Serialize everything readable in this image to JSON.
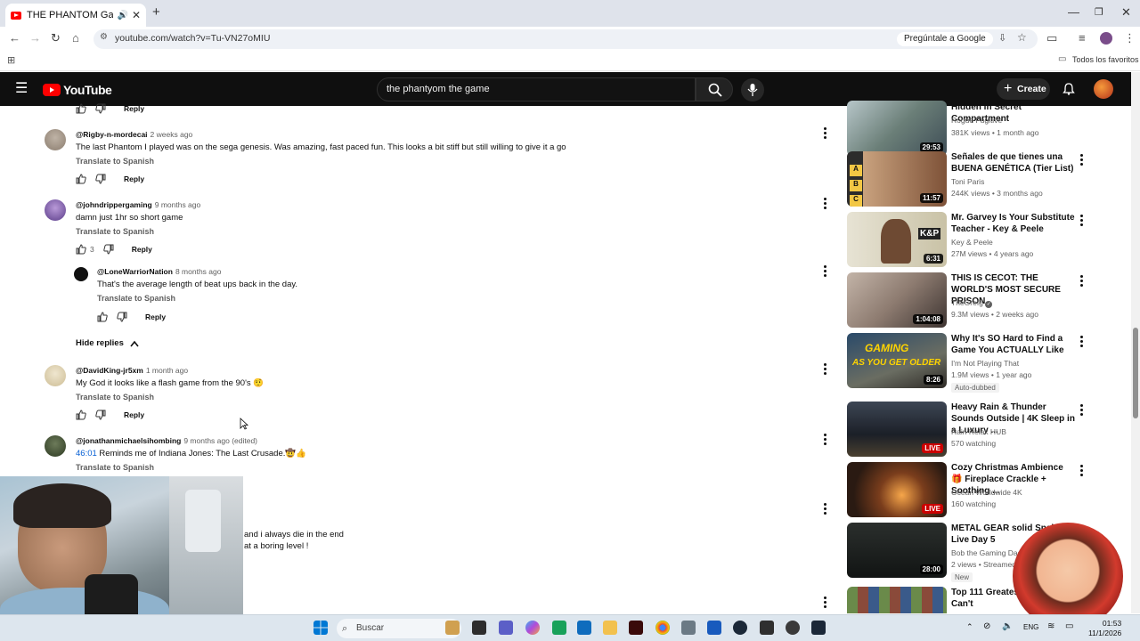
{
  "browser": {
    "tab_title": "THE PHANTOM Gameplay",
    "tab_close": "✕",
    "new_tab": "+",
    "url": "youtube.com/watch?v=Tu-VN27oMIU",
    "ask_google": "Pregúntale a Google",
    "all_bookmarks": "Todos los favoritos"
  },
  "youtube": {
    "logo_text": "YouTube",
    "search_value": "the phantyom the game",
    "create_label": "Create"
  },
  "comments": [
    {
      "handle": "@Rigby-n-mordecai",
      "age": "2 weeks ago",
      "text": "The last Phantom I played was on the sega genesis. Was amazing, fast paced fun. This looks a bit stiff but still willing to give it a go",
      "translate": "Translate to Spanish",
      "reply": "Reply"
    },
    {
      "handle": "@johndrippergaming",
      "age": "9 months ago",
      "text": "damn just 1hr so short game",
      "translate": "Translate to Spanish",
      "likes": "3",
      "reply": "Reply"
    },
    {
      "handle": "@LoneWarriorNation",
      "age": "8 months ago",
      "text": "That's the average length of beat ups back in the day.",
      "translate": "Translate to Spanish",
      "reply": "Reply"
    },
    {
      "handle": "@DavidKing-jr5xm",
      "age": "1 month ago",
      "text": "My God it looks like a flash game from the 90's 🤨",
      "translate": "Translate to Spanish",
      "reply": "Reply"
    },
    {
      "handle": "@jonathanmichaelsihombing",
      "age": "9 months ago (edited)",
      "timestamp": "46:01",
      "text": " Reminds me of Indiana Jones: The Last Crusade.🤠👍",
      "translate": "Translate to Spanish"
    }
  ],
  "top_reply": "Reply",
  "hide_replies": "Hide replies",
  "partial_comment": {
    "line1": "and i always die in the end",
    "line2": "at a boring level !"
  },
  "sidebar": [
    {
      "title": "Hidden in Secret Compartment",
      "channel": "Rogue Fugitive",
      "meta": "381K views • 1 month ago",
      "duration": "29:53"
    },
    {
      "title": "Señales de que tienes una BUENA GENÉTICA (Tier List)",
      "channel": "Toni Paris",
      "meta": "244K views • 3 months ago",
      "duration": "11:57"
    },
    {
      "title": "Mr. Garvey Is Your Substitute Teacher - Key & Peele",
      "channel": "Key & Peele",
      "meta": "27M views • 4 years ago",
      "duration": "6:31"
    },
    {
      "title": "THIS IS CECOT: THE WORLD'S MOST SECURE PRISON",
      "channel": "TheGrefg",
      "meta": "9.3M views • 2 weeks ago",
      "duration": "1:04:08"
    },
    {
      "title": "Why It's SO Hard to Find a Game You ACTUALLY Like",
      "channel": "I'm Not Playing That",
      "meta": "1.9M views • 1 year ago",
      "duration": "8:26",
      "badge": "Auto-dubbed"
    },
    {
      "title": "Heavy Rain & Thunder Sounds Outside | 4K Sleep in a Luxury ...",
      "channel": "Rain Relax HUB",
      "meta": "570 watching",
      "live": "LIVE"
    },
    {
      "title": "Cozy Christmas Ambience 🎁 Fireplace Crackle + Soothing ...",
      "channel": "Ocean Worldwide 4K",
      "meta": "160 watching",
      "live": "LIVE"
    },
    {
      "title": "METAL GEAR solid Snake Live Day 5",
      "channel": "Bob the Gaming Dad",
      "meta": "2 views • Streamed",
      "duration": "28:00",
      "badge": "New"
    },
    {
      "title": "Top 111 Greatest Games You Can't",
      "channel": "",
      "meta": ""
    }
  ],
  "thumb_texts": {
    "gaming1": "GAMING",
    "gaming2": "AS YOU GET OLDER",
    "tier_labels": [
      "A",
      "B",
      "C"
    ],
    "kp": "K&P"
  },
  "taskbar": {
    "search": "Buscar",
    "lang": "ENG",
    "time": "01:53",
    "date": "11/1/2026"
  },
  "colors": {
    "youtube_red": "#ff0000",
    "link_blue": "#065fd4",
    "header_bg": "#0f0f0f"
  }
}
